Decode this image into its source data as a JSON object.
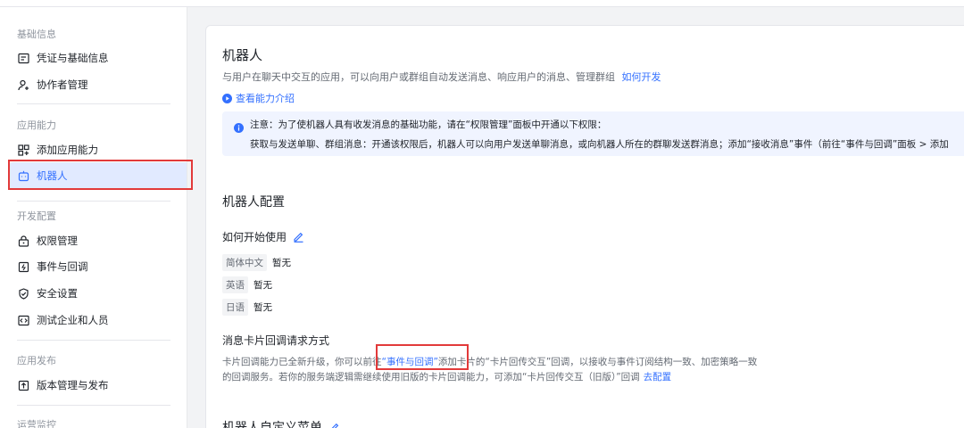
{
  "sidebar": {
    "groups": [
      {
        "title": "基础信息",
        "items": [
          {
            "label": "凭证与基础信息",
            "icon": "id-card-icon"
          },
          {
            "label": "协作者管理",
            "icon": "user-add-icon"
          }
        ]
      },
      {
        "title": "应用能力",
        "items": [
          {
            "label": "添加应用能力",
            "icon": "grid-add-icon"
          },
          {
            "label": "机器人",
            "icon": "robot-icon",
            "active": true
          }
        ]
      },
      {
        "title": "开发配置",
        "items": [
          {
            "label": "权限管理",
            "icon": "lock-icon"
          },
          {
            "label": "事件与回调",
            "icon": "event-icon"
          },
          {
            "label": "安全设置",
            "icon": "shield-check-icon"
          },
          {
            "label": "测试企业和人员",
            "icon": "code-icon"
          }
        ]
      },
      {
        "title": "应用发布",
        "items": [
          {
            "label": "版本管理与发布",
            "icon": "upload-icon"
          }
        ]
      },
      {
        "title": "运营监控",
        "items": []
      }
    ]
  },
  "main": {
    "title": "机器人",
    "description": "与用户在聊天中交互的应用，可以向用户或群组自动发送消息、响应用户的消息、管理群组",
    "dev_link": "如何开发",
    "intro_link": "查看能力介绍",
    "notice": {
      "line1": "注意：为了使机器人具有收发消息的基础功能，请在“权限管理”面板中开通以下权限：",
      "line2": "获取与发送单聊、群组消息：开通该权限后，机器人可以向用户发送单聊消息，或向机器人所在的群聊发送群消息；添加“接收消息”事件（前往“事件与回调”面板 > 添加"
    },
    "config_title": "机器人配置",
    "how_to_use": {
      "title": "如何开始使用",
      "rows": [
        {
          "lang": "简体中文",
          "value": "暂无"
        },
        {
          "lang": "英语",
          "value": "暂无"
        },
        {
          "lang": "日语",
          "value": "暂无"
        }
      ]
    },
    "card_callback": {
      "title": "消息卡片回调请求方式",
      "line1_a": "卡片回调能力已全新升级，你可以前往",
      "line1_link": "“事件与回调”",
      "line1_b": "添加卡片的“卡片回传交互”回调，以接收与事件订阅结构一致、加密策略一致",
      "line2_a": "的回调服务。若你的服务端逻辑需继续使用旧版的卡片回调能力，可添加“卡片回传交互（旧版）”回调",
      "line2_link": "去配置"
    },
    "menu_title": "机器人自定义菜单"
  },
  "colors": {
    "accent": "#3370ff",
    "highlight_box": "#e23a3a",
    "active_bg": "#e1eaff",
    "notice_bg": "#f0f4ff"
  }
}
